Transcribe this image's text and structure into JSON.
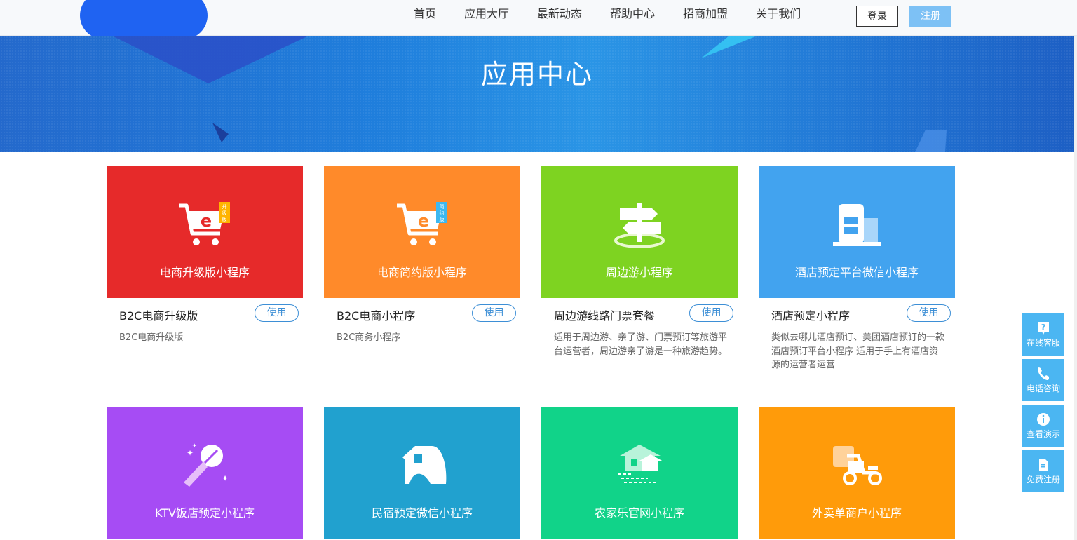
{
  "nav": {
    "items": [
      "首页",
      "应用大厅",
      "最新动态",
      "帮助中心",
      "招商加盟",
      "关于我们"
    ],
    "login_label": "登录",
    "register_label": "注册"
  },
  "banner": {
    "title": "应用中心"
  },
  "cards": [
    {
      "title": "电商升级版小程序",
      "name": "B2C电商升级版",
      "button": "使用",
      "desc": "B2C电商升级版",
      "color": "#e62a2a",
      "icon": "shopping-cart-upgrade-icon",
      "badge": "升级版"
    },
    {
      "title": "电商简约版小程序",
      "name": "B2C电商小程序",
      "button": "使用",
      "desc": "B2C商务小程序",
      "color": "#ff8a2a",
      "icon": "shopping-cart-simple-icon",
      "badge": "简约版"
    },
    {
      "title": "周边游小程序",
      "name": "周边游线路门票套餐",
      "button": "使用",
      "desc": "适用于周边游、亲子游、门票预订等旅游平台运营者，周边游亲子游是一种旅游趋势。",
      "color": "#7ed321",
      "icon": "signpost-icon"
    },
    {
      "title": "酒店预定平台微信小程序",
      "name": "酒店预定小程序",
      "button": "使用",
      "desc": "类似去哪儿酒店预订、美团酒店预订的一款酒店预订平台小程序 适用于手上有酒店资源的运营者运营",
      "color": "#42a3ef",
      "icon": "hotel-building-icon"
    },
    {
      "title": "KTV饭店预定小程序",
      "color": "#a64cf4",
      "icon": "microphone-icon"
    },
    {
      "title": "民宿预定微信小程序",
      "color": "#21a1cf",
      "icon": "homestay-icon"
    },
    {
      "title": "农家乐官网小程序",
      "color": "#11d389",
      "icon": "farmhouse-icon"
    },
    {
      "title": "外卖单商户小程序",
      "color": "#ff9b0a",
      "icon": "delivery-scooter-icon"
    }
  ],
  "side_bar": [
    {
      "label": "在线客服",
      "icon": "question-icon"
    },
    {
      "label": "电话咨询",
      "icon": "phone-icon"
    },
    {
      "label": "查看演示",
      "icon": "info-icon"
    },
    {
      "label": "免费注册",
      "icon": "document-icon"
    }
  ]
}
